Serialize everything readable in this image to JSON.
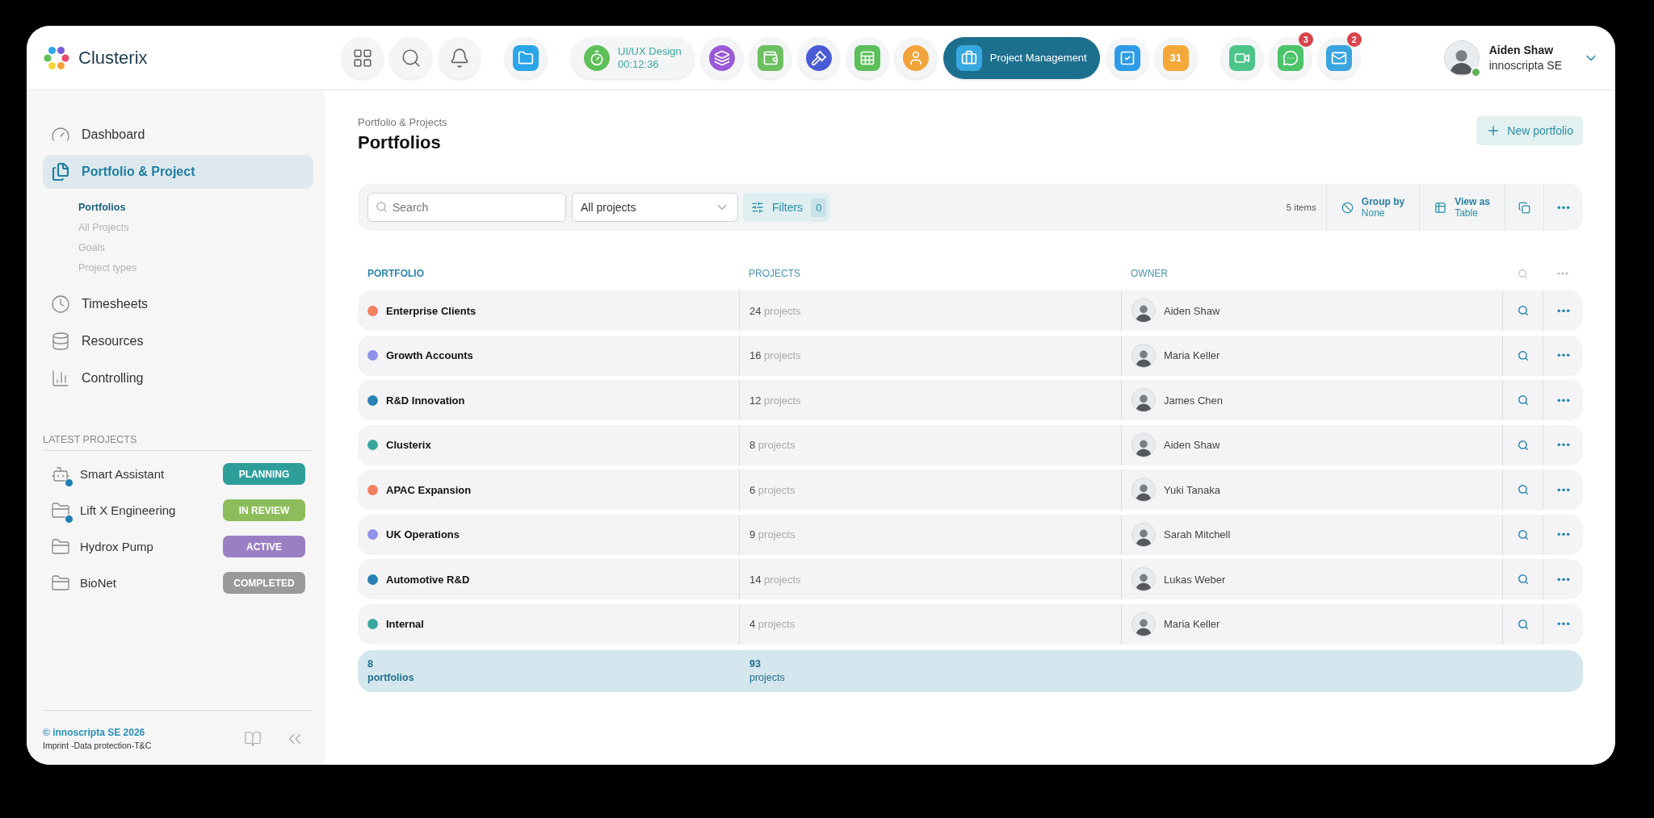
{
  "brand": {
    "name": "Clusterix"
  },
  "apps": [
    {
      "kind": "grid"
    },
    {
      "kind": "search"
    },
    {
      "kind": "bell"
    },
    {
      "kind": "folder"
    },
    {
      "kind": "timer",
      "label": "UI/UX Design",
      "time": "00:12:36"
    },
    {
      "kind": "layers"
    },
    {
      "kind": "wallet"
    },
    {
      "kind": "gavel"
    },
    {
      "kind": "sheet"
    },
    {
      "kind": "user"
    },
    {
      "kind": "briefcase",
      "label": "Project Management",
      "selected": true
    },
    {
      "kind": "check"
    },
    {
      "kind": "calendar",
      "label": "31"
    },
    {
      "kind": "video"
    },
    {
      "kind": "chat",
      "badge": "3"
    },
    {
      "kind": "mail",
      "badge": "2"
    }
  ],
  "user": {
    "name": "Aiden Shaw",
    "company": "innoscripta SE",
    "online": true
  },
  "sidebar": {
    "items": [
      {
        "label": "Dashboard",
        "selected": false
      },
      {
        "label": "Portfolio & Project",
        "selected": true,
        "children": [
          {
            "label": "Portfolios",
            "selected": true
          },
          {
            "label": "All Projects",
            "selected": false
          },
          {
            "label": "Goals",
            "selected": false
          },
          {
            "label": "Project types",
            "selected": false
          }
        ]
      },
      {
        "label": "Timesheets",
        "selected": false
      },
      {
        "label": "Resources",
        "selected": false
      },
      {
        "label": "Controlling",
        "selected": false
      }
    ],
    "latest_title": "LATEST PROJECTS",
    "latest": [
      {
        "name": "Smart Assistant",
        "status": "PLANNING",
        "color": "#2e9e9a",
        "shared": true
      },
      {
        "name": "Lift X Engineering",
        "status": "IN REVIEW",
        "color": "#8cbd5a",
        "shared": true
      },
      {
        "name": "Hydrox Pump",
        "status": "ACTIVE",
        "color": "#9b7fc4",
        "shared": false
      },
      {
        "name": "BioNet",
        "status": "COMPLETED",
        "color": "#9a9a9a",
        "shared": false
      }
    ],
    "copyright": "© innoscripta SE 2026",
    "links": "Imprint -Data protection-T&C"
  },
  "page": {
    "breadcrumb": "Portfolio & Projects",
    "title": "Portfolios",
    "new_button": "New portfolio"
  },
  "toolbar": {
    "search_placeholder": "Search",
    "dropdown": "All projects",
    "filters": "Filters",
    "filter_count": "0",
    "items": "5 items",
    "group_by": "Group by",
    "group_value": "None",
    "view_as": "View as",
    "view_value": "Table"
  },
  "table": {
    "columns": [
      "PORTFOLIO",
      "PROJECTS",
      "OWNER"
    ],
    "rows": [
      {
        "name": "Enterprise Clients",
        "color": "#f08060",
        "count": "24",
        "unit": "projects",
        "owner": "Aiden Shaw"
      },
      {
        "name": "Growth Accounts",
        "color": "#8f92ea",
        "count": "16",
        "unit": "projects",
        "owner": "Maria Keller"
      },
      {
        "name": "R&D Innovation",
        "color": "#2a82b4",
        "count": "12",
        "unit": "projects",
        "owner": "James Chen"
      },
      {
        "name": "Clusterix",
        "color": "#3aa79c",
        "count": "8",
        "unit": "projects",
        "owner": "Aiden Shaw"
      },
      {
        "name": "APAC Expansion",
        "color": "#f08060",
        "count": "6",
        "unit": "projects",
        "owner": "Yuki Tanaka"
      },
      {
        "name": "UK Operations",
        "color": "#8f92ea",
        "count": "9",
        "unit": "projects",
        "owner": "Sarah Mitchell"
      },
      {
        "name": "Automotive R&D",
        "color": "#2a82b4",
        "count": "14",
        "unit": "projects",
        "owner": "Lukas Weber"
      },
      {
        "name": "Internal",
        "color": "#3aa79c",
        "count": "4",
        "unit": "projects",
        "owner": "Maria Keller"
      }
    ],
    "footer": {
      "portfolios": "8",
      "portfolios_label": "portfolios",
      "projects": "93",
      "projects_label": "projects"
    }
  }
}
